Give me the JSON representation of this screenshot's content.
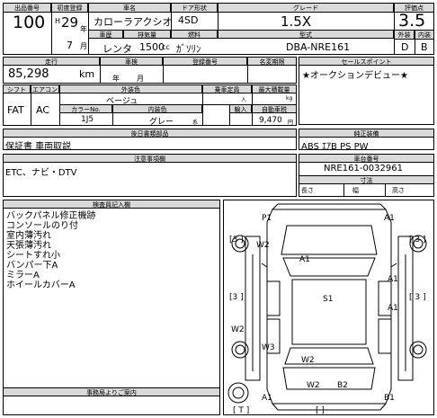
{
  "header": {
    "lot_label": "出品番号",
    "lot_number": "100",
    "reg_year_label": "初度登録",
    "era": "H",
    "year": "29",
    "year_unit": "年",
    "month": "7",
    "month_unit": "月",
    "name_label": "車名",
    "car_name": "カローラアクシオ",
    "door_label": "ドア形状",
    "door": "4SD",
    "grade_label": "グレード",
    "grade": "1.5X",
    "score_label": "評価点",
    "score": "3.5",
    "usage_label": "車歴",
    "usage": "レンタ",
    "disp_label": "排気量",
    "displacement": "1500",
    "disp_unit": "cc",
    "fuel_label": "燃料",
    "fuel": "ｶﾞｿﾘﾝ",
    "model_label": "型式",
    "model": "DBA-NRE161",
    "ext_label": "外装",
    "int_label": "内装",
    "ext_grade": "D",
    "int_grade": "B"
  },
  "row2": {
    "mileage_label": "走行",
    "mileage": "85,298",
    "mileage_unit": "km",
    "inspection_label": "車検",
    "year_unit": "年",
    "month_unit": "月",
    "reg_no_label": "登録番号",
    "transfer_label": "名変期限",
    "sales_point_label": "セールスポイント",
    "sales_point": "★オークションデビュー★"
  },
  "row3": {
    "shift_label": "シフト",
    "ac_label": "エアコン",
    "shift": "FAT",
    "ac": "AC",
    "color_label": "外装色",
    "color": "ベージュ",
    "color_code_label": "カラーNo.",
    "color_code": "1J5",
    "int_color_label": "内装色",
    "int_color": "グレー",
    "int_color_suffix": "系",
    "capacity_label": "乗車定員",
    "person_unit": "人",
    "payload_label": "最大積載量",
    "kg_unit": "kg",
    "import_label": "輸入",
    "tax_label": "自動車税",
    "tax": "9,470",
    "tax_unit": "円"
  },
  "docs": {
    "label": "後日書類部品",
    "value": "保証書 車両取説",
    "equip_label": "純正装備",
    "equip_value": "ABS ｴｱB PS PW"
  },
  "notes": {
    "label": "注意事項欄",
    "value": "ETC、ナビ・DTV",
    "frame_label": "車台番号",
    "frame_no": "NRE161-0032961",
    "size_label": "寸法",
    "length_label": "長さ",
    "width_label": "幅",
    "height_label": "高さ"
  },
  "inspector": {
    "label": "検査員記入欄",
    "lines": [
      "バックパネル修正機跡",
      "コンソールのり付",
      "室内薄汚れ",
      "天張薄汚れ",
      "シートすれ小",
      "バンパー下A",
      "ミラーA",
      "ホイールカバーA"
    ],
    "office_label": "事務局よりご案内"
  },
  "diagram": {
    "marks": {
      "p1": "P1",
      "a1_front_right": "A1",
      "w2_left": "W2",
      "a1_hood": "A1",
      "a1_door": "A1",
      "s1": "S1",
      "w2_lower_left": "W2",
      "w3": "W3",
      "a1_right_lower": "A1",
      "w2_rear": "W2",
      "w2_bottom": "W2",
      "b2": "B2",
      "a1_rear_left": "A1",
      "b1": "B1",
      "bracket_left_top": "[3 ]",
      "bracket_right_top": "[ 3 ]",
      "bracket_left_mid": "[3 ]",
      "bracket_right_mid": "[ 3 ]",
      "bracket_bottom": "[ T ]",
      "bracket_top": "[ ]"
    }
  }
}
